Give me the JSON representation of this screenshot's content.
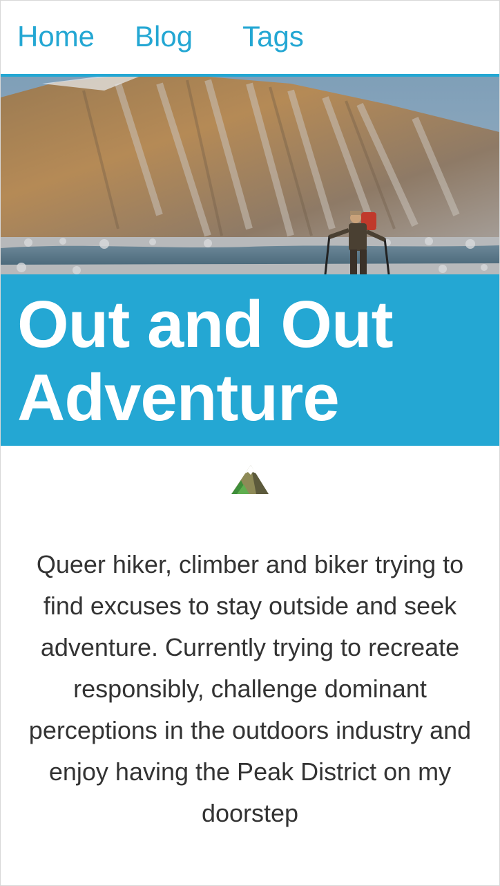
{
  "nav": {
    "items": [
      {
        "label": "Home"
      },
      {
        "label": "Blog"
      },
      {
        "label": "Tags"
      }
    ]
  },
  "site": {
    "title": "Out and Out Adventure",
    "emoji_icon": "mountain-emoji-icon",
    "bio": "Queer hiker, climber and biker trying to find excuses to stay outside and seek adventure. Currently trying to recreate responsibly, challenge dominant perceptions in the outdoors industry and enjoy having the Peak District on my doorstep"
  },
  "colors": {
    "accent": "#24a7d3",
    "text": "#333333",
    "background": "#ffffff"
  }
}
